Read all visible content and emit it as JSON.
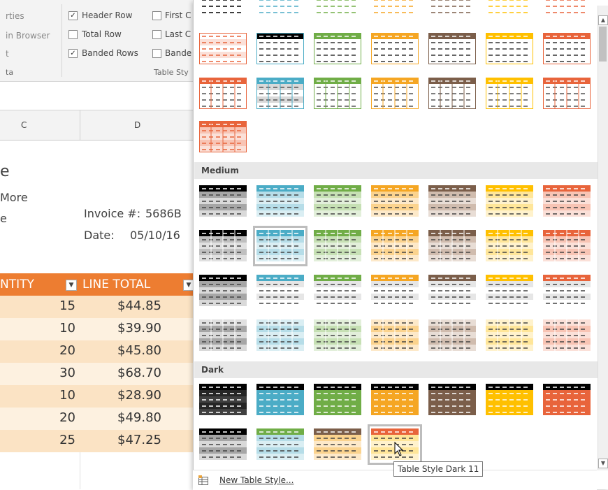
{
  "ribbon": {
    "left_items": [
      "rties",
      "in Browser",
      "t",
      "ta"
    ],
    "checkboxes": [
      {
        "label": "Header Row",
        "checked": true
      },
      {
        "label": "Total Row",
        "checked": false
      },
      {
        "label": "Banded Rows",
        "checked": true
      },
      {
        "label": "First C",
        "checked": false
      },
      {
        "label": "Last C",
        "checked": false
      },
      {
        "label": "Bande",
        "checked": false
      }
    ],
    "group_label": "Table Sty"
  },
  "columns": [
    "C",
    "D"
  ],
  "sheet": {
    "title_partial": "e",
    "line2": "More",
    "line3": "e",
    "invoice_label": "Invoice #:",
    "invoice_value": "5686B",
    "date_label": "Date:",
    "date_value": "05/10/16",
    "header_qty": "NTITY",
    "header_total": "LINE TOTAL",
    "rows": [
      {
        "qty": "15",
        "total": "$44.85"
      },
      {
        "qty": "10",
        "total": "$39.90"
      },
      {
        "qty": "20",
        "total": "$45.80"
      },
      {
        "qty": "30",
        "total": "$68.70"
      },
      {
        "qty": "10",
        "total": "$28.90"
      },
      {
        "qty": "20",
        "total": "$49.80"
      },
      {
        "qty": "25",
        "total": "$47.25"
      }
    ]
  },
  "gallery": {
    "sections": [
      "Medium",
      "Dark"
    ],
    "new_style": "New Table Style...",
    "tooltip": "Table Style Dark 11"
  },
  "colors": {
    "orange": "#ed7d31",
    "light_orange": "#fbe5d6",
    "mid_orange": "#f8cbad",
    "black": "#000000",
    "blue": "#4bacc6",
    "green": "#70ad47",
    "amber": "#ed7d31",
    "brown": "#7b5e4a",
    "gold": "#ffc000",
    "red_orange": "#e8643b"
  }
}
